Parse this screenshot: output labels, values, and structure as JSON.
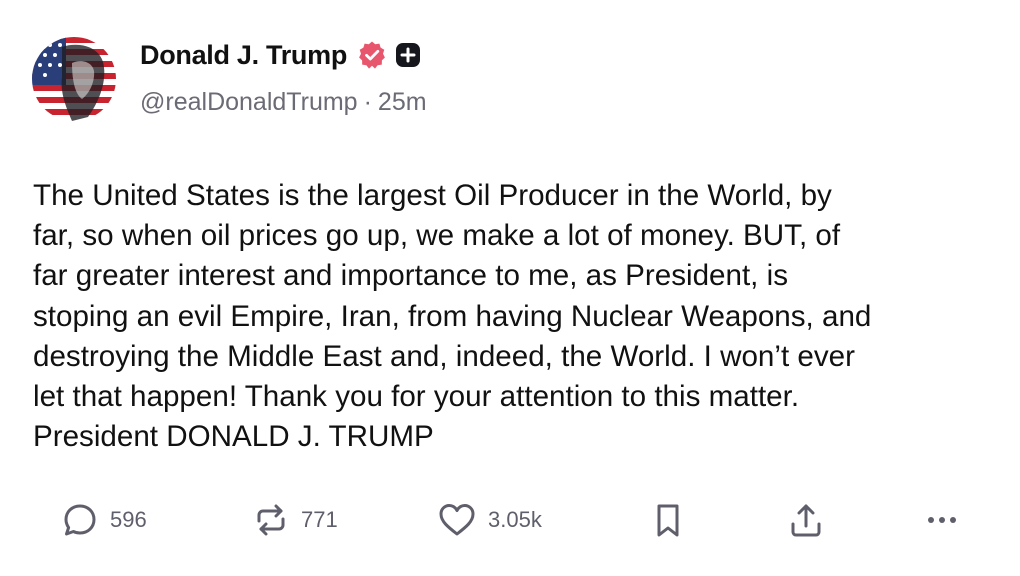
{
  "author": {
    "display_name": "Donald J. Trump",
    "handle": "@realDonaldTrump",
    "separator": "·",
    "time": "25m",
    "verified_icon": "verified-badge-icon",
    "plus_icon": "plus-badge-icon",
    "verified_color": "#e8566e"
  },
  "post": {
    "text": "The United States is the largest Oil Producer in the World, by\nfar, so when oil prices go up, we make a lot of money. BUT, of\nfar greater interest and importance to me, as President, is\nstoping an evil Empire, Iran, from having Nuclear Weapons, and\ndestroying the Middle East and, indeed, the World. I won’t ever\nlet that happen! Thank you for your attention to this matter.\nPresident DONALD J. TRUMP"
  },
  "actions": {
    "replies": {
      "icon": "reply-icon",
      "count": "596"
    },
    "retruths": {
      "icon": "repost-icon",
      "count": "771"
    },
    "likes": {
      "icon": "heart-icon",
      "count": "3.05k"
    },
    "bookmark": {
      "icon": "bookmark-icon"
    },
    "share": {
      "icon": "share-icon"
    },
    "more": {
      "icon": "more-icon"
    }
  },
  "colors": {
    "text": "#111111",
    "muted": "#6b6b75",
    "icon": "#5f5f6b"
  }
}
